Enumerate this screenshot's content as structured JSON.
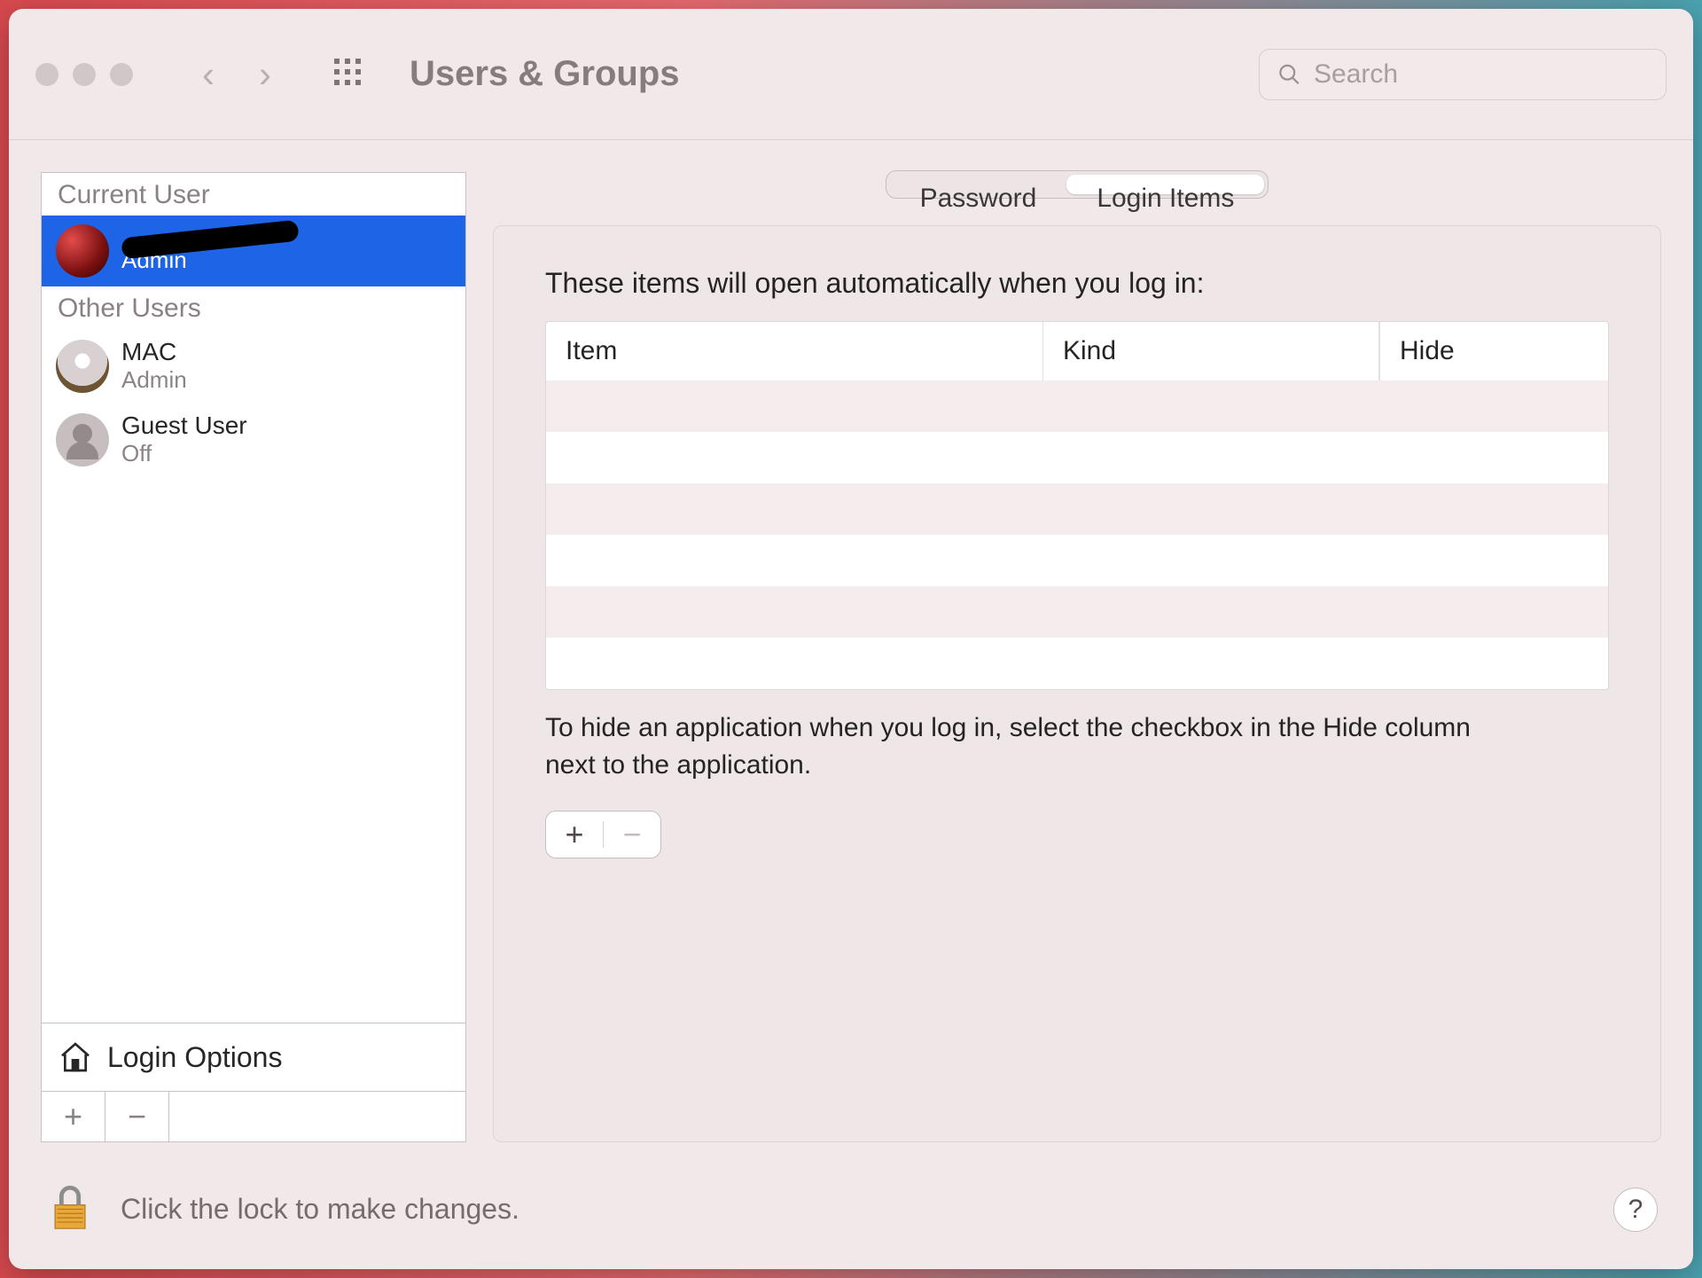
{
  "window": {
    "title": "Users & Groups"
  },
  "search": {
    "placeholder": "Search",
    "value": ""
  },
  "sidebar": {
    "current_header": "Current User",
    "other_header": "Other Users",
    "current_user": {
      "name": "████████",
      "role": "Admin"
    },
    "other_users": [
      {
        "name": "MAC",
        "role": "Admin"
      },
      {
        "name": "Guest User",
        "role": "Off"
      }
    ],
    "login_options_label": "Login Options"
  },
  "tabs": {
    "password": "Password",
    "login_items": "Login Items",
    "active": "login_items"
  },
  "panel": {
    "intro": "These items will open automatically when you log in:",
    "columns": {
      "item": "Item",
      "kind": "Kind",
      "hide": "Hide"
    },
    "rows": [],
    "hint": "To hide an application when you log in, select the checkbox in the Hide column next to the application."
  },
  "footer": {
    "lock_text": "Click the lock to make changes.",
    "help": "?"
  }
}
